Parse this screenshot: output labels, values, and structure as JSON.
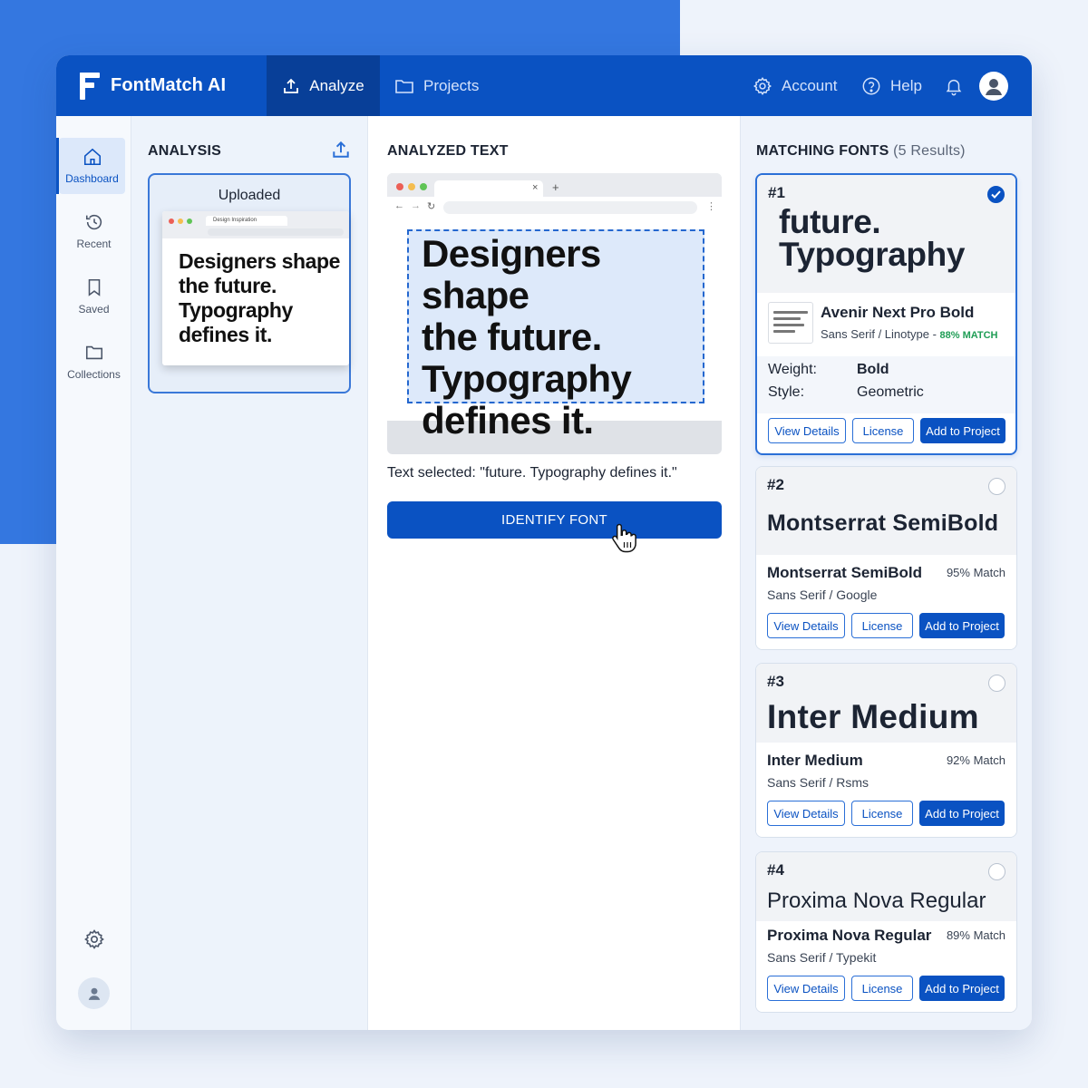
{
  "app": {
    "name": "FontMatch AI"
  },
  "nav": {
    "tabs": [
      {
        "label": "Analyze",
        "active": true,
        "icon": "upload-icon"
      },
      {
        "label": "Projects",
        "active": false,
        "icon": "folder-icon"
      }
    ],
    "right": [
      {
        "label": "Account",
        "icon": "gear-icon"
      },
      {
        "label": "Help",
        "icon": "help-circle-icon"
      }
    ],
    "notifications_icon": "bell-icon",
    "avatar_icon": "user-avatar-icon"
  },
  "sidebar": {
    "items": [
      {
        "label": "Dashboard",
        "icon": "home-icon",
        "active": true
      },
      {
        "label": "Recent",
        "icon": "history-icon",
        "active": false
      },
      {
        "label": "Saved",
        "icon": "bookmark-icon",
        "active": false
      },
      {
        "label": "Collections",
        "icon": "folder-icon",
        "active": false
      }
    ],
    "settings_icon": "gear-icon",
    "profile_icon": "user-avatar-icon"
  },
  "analysis": {
    "title": "ANALYSIS",
    "upload_label": "Uploaded",
    "mini_tab_title": "Design Inspiration",
    "preview_lines": [
      "Designers shape",
      "the future.",
      "Typography",
      "defines it."
    ]
  },
  "analyzed": {
    "title": "ANALYZED TEXT",
    "text_lines": [
      "Designers shape",
      "the future.",
      "Typography",
      "defines it."
    ],
    "selected_caption": "Text selected: \"future. Typography defines it.\"",
    "button_label": "IDENTIFY FONT"
  },
  "matches": {
    "title": "MATCHING FONTS",
    "count_label": "(5 Results)",
    "cards": [
      {
        "rank": "#1",
        "preview_lines": [
          "future.",
          "Typography"
        ],
        "name": "Avenir Next Pro Bold",
        "meta": "Sans Serif / Linotype - ",
        "match": "88% MATCH",
        "selected": true,
        "details": [
          {
            "label": "Weight:",
            "value": "Bold"
          },
          {
            "label": "Style:",
            "value": "Geometric"
          }
        ]
      },
      {
        "rank": "#2",
        "preview": "Montserrat SemiBold",
        "name": "Montserrat SemiBold",
        "meta": "Sans Serif / Google",
        "match": "95% Match",
        "selected": false
      },
      {
        "rank": "#3",
        "preview": "Inter Medium",
        "name": "Inter Medium",
        "meta": "Sans Serif / Rsms",
        "match": "92% Match",
        "selected": false
      },
      {
        "rank": "#4",
        "preview": "Proxima Nova Regular",
        "name": "Proxima Nova Regular",
        "meta": "Sans Serif / Typekit",
        "match": "89% Match",
        "selected": false
      }
    ],
    "buttons": {
      "details": "View Details",
      "license": "License",
      "add": "Add to Project"
    }
  },
  "colors": {
    "primary": "#0a52c2",
    "accent_bg": "#3477e0",
    "match_green": "#1f9d55"
  }
}
